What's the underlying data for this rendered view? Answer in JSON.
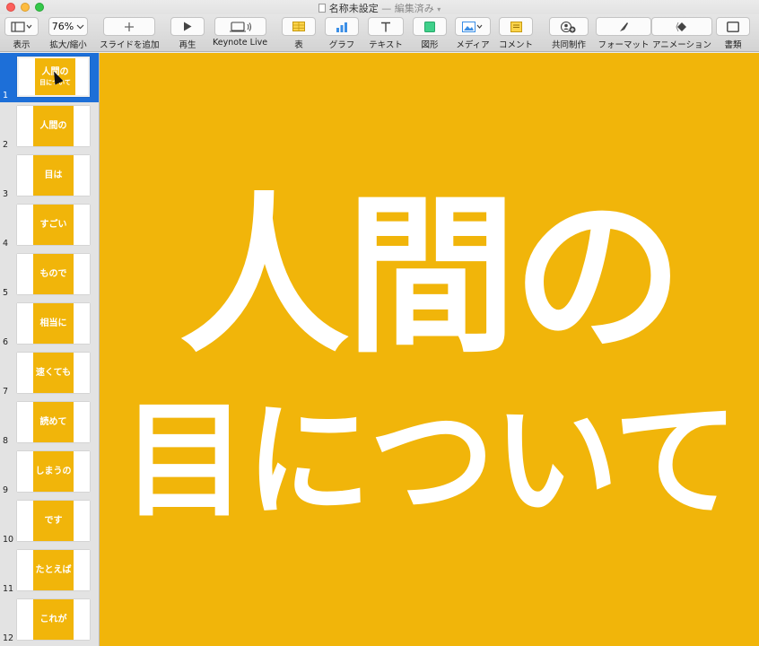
{
  "window": {
    "title": "名称未設定",
    "status": "— 編集済み",
    "colors": {
      "close": "#fc605c",
      "minimize": "#fdbc40",
      "maximize": "#34c84a"
    }
  },
  "toolbar": {
    "view": {
      "label": "表示",
      "icon": "sidebar-view-icon"
    },
    "zoom": {
      "label": "拡大/縮小",
      "value": "76%"
    },
    "add_slide": {
      "label": "スライドを追加",
      "icon": "plus-icon"
    },
    "play": {
      "label": "再生",
      "icon": "play-icon"
    },
    "keynote_live": {
      "label": "Keynote Live",
      "icon": "keynote-live-icon"
    },
    "table": {
      "label": "表",
      "icon": "table-icon"
    },
    "chart": {
      "label": "グラフ",
      "icon": "bar-chart-icon"
    },
    "text": {
      "label": "テキスト",
      "icon": "text-icon"
    },
    "shape": {
      "label": "図形",
      "icon": "shape-icon"
    },
    "media": {
      "label": "メディア",
      "icon": "media-icon"
    },
    "comment": {
      "label": "コメント",
      "icon": "comment-icon"
    },
    "collaborate": {
      "label": "共同制作",
      "icon": "collaborate-icon"
    },
    "format": {
      "label": "フォーマット",
      "icon": "format-brush-icon"
    },
    "animate": {
      "label": "アニメーション",
      "icon": "animate-icon"
    },
    "document": {
      "label": "書類",
      "icon": "document-icon"
    }
  },
  "slides": [
    {
      "num": "1",
      "line1": "人間の",
      "line2": "目について"
    },
    {
      "num": "2",
      "line1": "人間の",
      "line2": ""
    },
    {
      "num": "3",
      "line1": "目は",
      "line2": ""
    },
    {
      "num": "4",
      "line1": "すごい",
      "line2": ""
    },
    {
      "num": "5",
      "line1": "もので",
      "line2": ""
    },
    {
      "num": "6",
      "line1": "相当に",
      "line2": ""
    },
    {
      "num": "7",
      "line1": "速くても",
      "line2": ""
    },
    {
      "num": "8",
      "line1": "読めて",
      "line2": ""
    },
    {
      "num": "9",
      "line1": "しまうの",
      "line2": ""
    },
    {
      "num": "10",
      "line1": "です",
      "line2": ""
    },
    {
      "num": "11",
      "line1": "たとえば",
      "line2": ""
    },
    {
      "num": "12",
      "line1": "これが",
      "line2": ""
    }
  ],
  "canvas": {
    "line1": "人間の",
    "line2": "目について",
    "background": "#f1b50a",
    "text_color": "#ffffff"
  }
}
